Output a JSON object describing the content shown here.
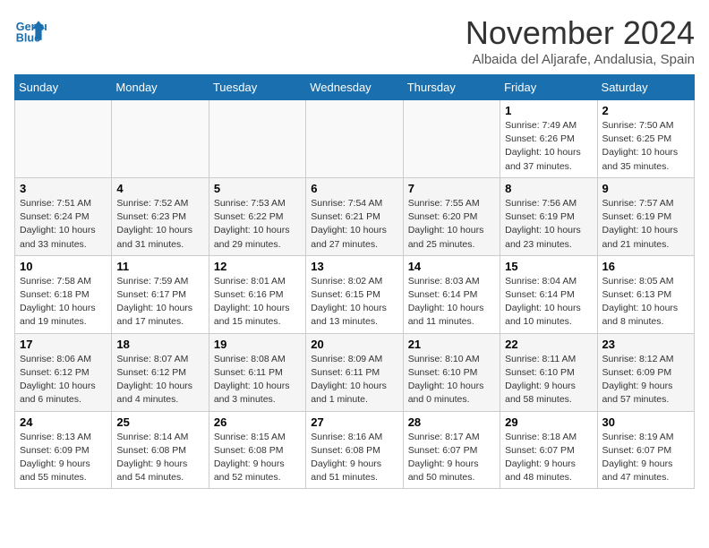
{
  "header": {
    "logo_line1": "General",
    "logo_line2": "Blue",
    "month_title": "November 2024",
    "location": "Albaida del Aljarafe, Andalusia, Spain"
  },
  "weekdays": [
    "Sunday",
    "Monday",
    "Tuesday",
    "Wednesday",
    "Thursday",
    "Friday",
    "Saturday"
  ],
  "weeks": [
    [
      {
        "day": null
      },
      {
        "day": null
      },
      {
        "day": null
      },
      {
        "day": null
      },
      {
        "day": null
      },
      {
        "day": "1",
        "sunrise": "7:49 AM",
        "sunset": "6:26 PM",
        "daylight": "10 hours and 37 minutes."
      },
      {
        "day": "2",
        "sunrise": "7:50 AM",
        "sunset": "6:25 PM",
        "daylight": "10 hours and 35 minutes."
      }
    ],
    [
      {
        "day": "3",
        "sunrise": "7:51 AM",
        "sunset": "6:24 PM",
        "daylight": "10 hours and 33 minutes."
      },
      {
        "day": "4",
        "sunrise": "7:52 AM",
        "sunset": "6:23 PM",
        "daylight": "10 hours and 31 minutes."
      },
      {
        "day": "5",
        "sunrise": "7:53 AM",
        "sunset": "6:22 PM",
        "daylight": "10 hours and 29 minutes."
      },
      {
        "day": "6",
        "sunrise": "7:54 AM",
        "sunset": "6:21 PM",
        "daylight": "10 hours and 27 minutes."
      },
      {
        "day": "7",
        "sunrise": "7:55 AM",
        "sunset": "6:20 PM",
        "daylight": "10 hours and 25 minutes."
      },
      {
        "day": "8",
        "sunrise": "7:56 AM",
        "sunset": "6:19 PM",
        "daylight": "10 hours and 23 minutes."
      },
      {
        "day": "9",
        "sunrise": "7:57 AM",
        "sunset": "6:19 PM",
        "daylight": "10 hours and 21 minutes."
      }
    ],
    [
      {
        "day": "10",
        "sunrise": "7:58 AM",
        "sunset": "6:18 PM",
        "daylight": "10 hours and 19 minutes."
      },
      {
        "day": "11",
        "sunrise": "7:59 AM",
        "sunset": "6:17 PM",
        "daylight": "10 hours and 17 minutes."
      },
      {
        "day": "12",
        "sunrise": "8:01 AM",
        "sunset": "6:16 PM",
        "daylight": "10 hours and 15 minutes."
      },
      {
        "day": "13",
        "sunrise": "8:02 AM",
        "sunset": "6:15 PM",
        "daylight": "10 hours and 13 minutes."
      },
      {
        "day": "14",
        "sunrise": "8:03 AM",
        "sunset": "6:14 PM",
        "daylight": "10 hours and 11 minutes."
      },
      {
        "day": "15",
        "sunrise": "8:04 AM",
        "sunset": "6:14 PM",
        "daylight": "10 hours and 10 minutes."
      },
      {
        "day": "16",
        "sunrise": "8:05 AM",
        "sunset": "6:13 PM",
        "daylight": "10 hours and 8 minutes."
      }
    ],
    [
      {
        "day": "17",
        "sunrise": "8:06 AM",
        "sunset": "6:12 PM",
        "daylight": "10 hours and 6 minutes."
      },
      {
        "day": "18",
        "sunrise": "8:07 AM",
        "sunset": "6:12 PM",
        "daylight": "10 hours and 4 minutes."
      },
      {
        "day": "19",
        "sunrise": "8:08 AM",
        "sunset": "6:11 PM",
        "daylight": "10 hours and 3 minutes."
      },
      {
        "day": "20",
        "sunrise": "8:09 AM",
        "sunset": "6:11 PM",
        "daylight": "10 hours and 1 minute."
      },
      {
        "day": "21",
        "sunrise": "8:10 AM",
        "sunset": "6:10 PM",
        "daylight": "10 hours and 0 minutes."
      },
      {
        "day": "22",
        "sunrise": "8:11 AM",
        "sunset": "6:10 PM",
        "daylight": "9 hours and 58 minutes."
      },
      {
        "day": "23",
        "sunrise": "8:12 AM",
        "sunset": "6:09 PM",
        "daylight": "9 hours and 57 minutes."
      }
    ],
    [
      {
        "day": "24",
        "sunrise": "8:13 AM",
        "sunset": "6:09 PM",
        "daylight": "9 hours and 55 minutes."
      },
      {
        "day": "25",
        "sunrise": "8:14 AM",
        "sunset": "6:08 PM",
        "daylight": "9 hours and 54 minutes."
      },
      {
        "day": "26",
        "sunrise": "8:15 AM",
        "sunset": "6:08 PM",
        "daylight": "9 hours and 52 minutes."
      },
      {
        "day": "27",
        "sunrise": "8:16 AM",
        "sunset": "6:08 PM",
        "daylight": "9 hours and 51 minutes."
      },
      {
        "day": "28",
        "sunrise": "8:17 AM",
        "sunset": "6:07 PM",
        "daylight": "9 hours and 50 minutes."
      },
      {
        "day": "29",
        "sunrise": "8:18 AM",
        "sunset": "6:07 PM",
        "daylight": "9 hours and 48 minutes."
      },
      {
        "day": "30",
        "sunrise": "8:19 AM",
        "sunset": "6:07 PM",
        "daylight": "9 hours and 47 minutes."
      }
    ]
  ]
}
